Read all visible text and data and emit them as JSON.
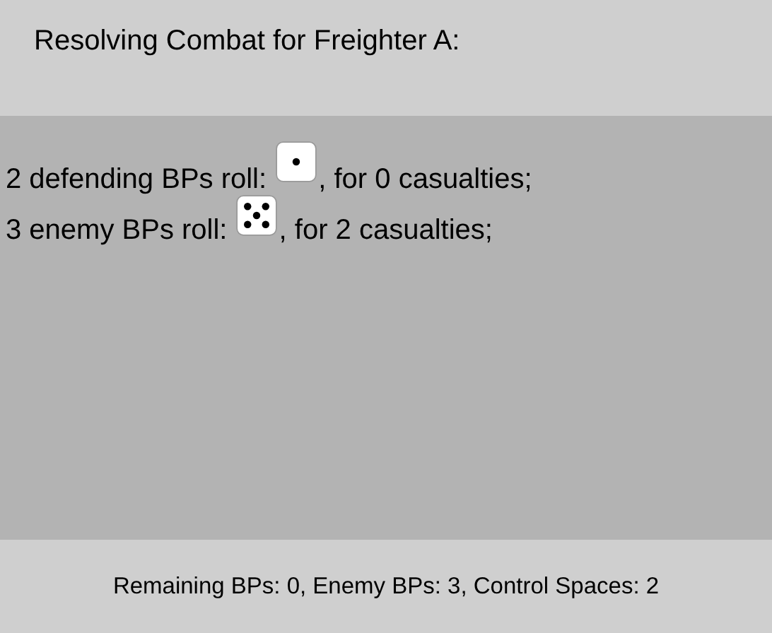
{
  "title": "Resolving Combat for Freighter A:",
  "rolls": [
    {
      "before": "2 defending BPs roll:",
      "kind": "one",
      "after": ", for 0 casualties;"
    },
    {
      "before": "3 enemy BPs roll:",
      "kind": "five",
      "after": ", for 2 casualties;"
    }
  ],
  "status": "Remaining BPs: 0, Enemy BPs: 3, Control Spaces: 2"
}
